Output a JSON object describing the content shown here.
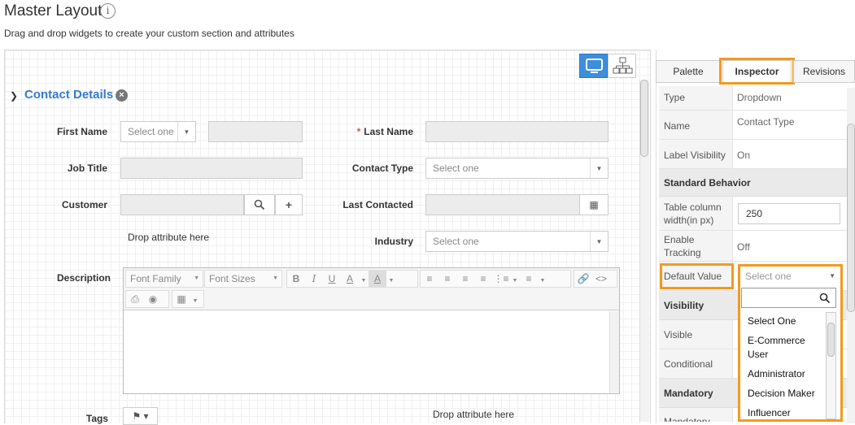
{
  "header": {
    "title": "Master Layout",
    "info_icon": "i",
    "subtitle": "Drag and drop widgets to create your custom section and attributes"
  },
  "section": {
    "title": "Contact Details",
    "collapse_icon": "chevron-down-icon",
    "remove_icon": "close-circle-icon"
  },
  "form": {
    "first_name_label": "First Name",
    "first_name_salutation": "Select one",
    "job_title_label": "Job Title",
    "customer_label": "Customer",
    "drop_attribute_left": "Drop attribute here",
    "description_label": "Description",
    "tags_label": "Tags",
    "last_name_label": "Last Name",
    "last_name_required": "*",
    "contact_type_label": "Contact Type",
    "contact_type_value": "Select one",
    "last_contacted_label": "Last Contacted",
    "industry_label": "Industry",
    "industry_value": "Select one",
    "drop_attribute_bottom": "Drop attribute here"
  },
  "editor": {
    "font_family": "Font Family",
    "font_sizes": "Font Sizes"
  },
  "tabs": {
    "palette": "Palette",
    "inspector": "Inspector",
    "revisions": "Revisions"
  },
  "inspector": {
    "type_key": "Type",
    "type_val": "Dropdown",
    "name_key": "Name",
    "name_val": "Contact Type",
    "label_vis_key": "Label Visibility",
    "label_vis_val": "On",
    "standard_behavior": "Standard Behavior",
    "table_col_key": "Table column width(in px)",
    "table_col_val": "250",
    "enable_tracking_key": "Enable Tracking",
    "enable_tracking_val": "Off",
    "default_value_key": "Default Value",
    "default_value_placeholder": "Select one",
    "visibility_head": "Visibility",
    "visible_key": "Visible",
    "conditional_key": "Conditional",
    "mandatory_head": "Mandatory",
    "mandatory_key": "Mandatory"
  },
  "dropdown_options": [
    "Select One",
    "E-Commerce User",
    "Administrator",
    "Decision Maker",
    "Influencer"
  ],
  "colors": {
    "accent": "#3579d1",
    "highlight": "#f39a1e",
    "required": "#d9534f"
  }
}
